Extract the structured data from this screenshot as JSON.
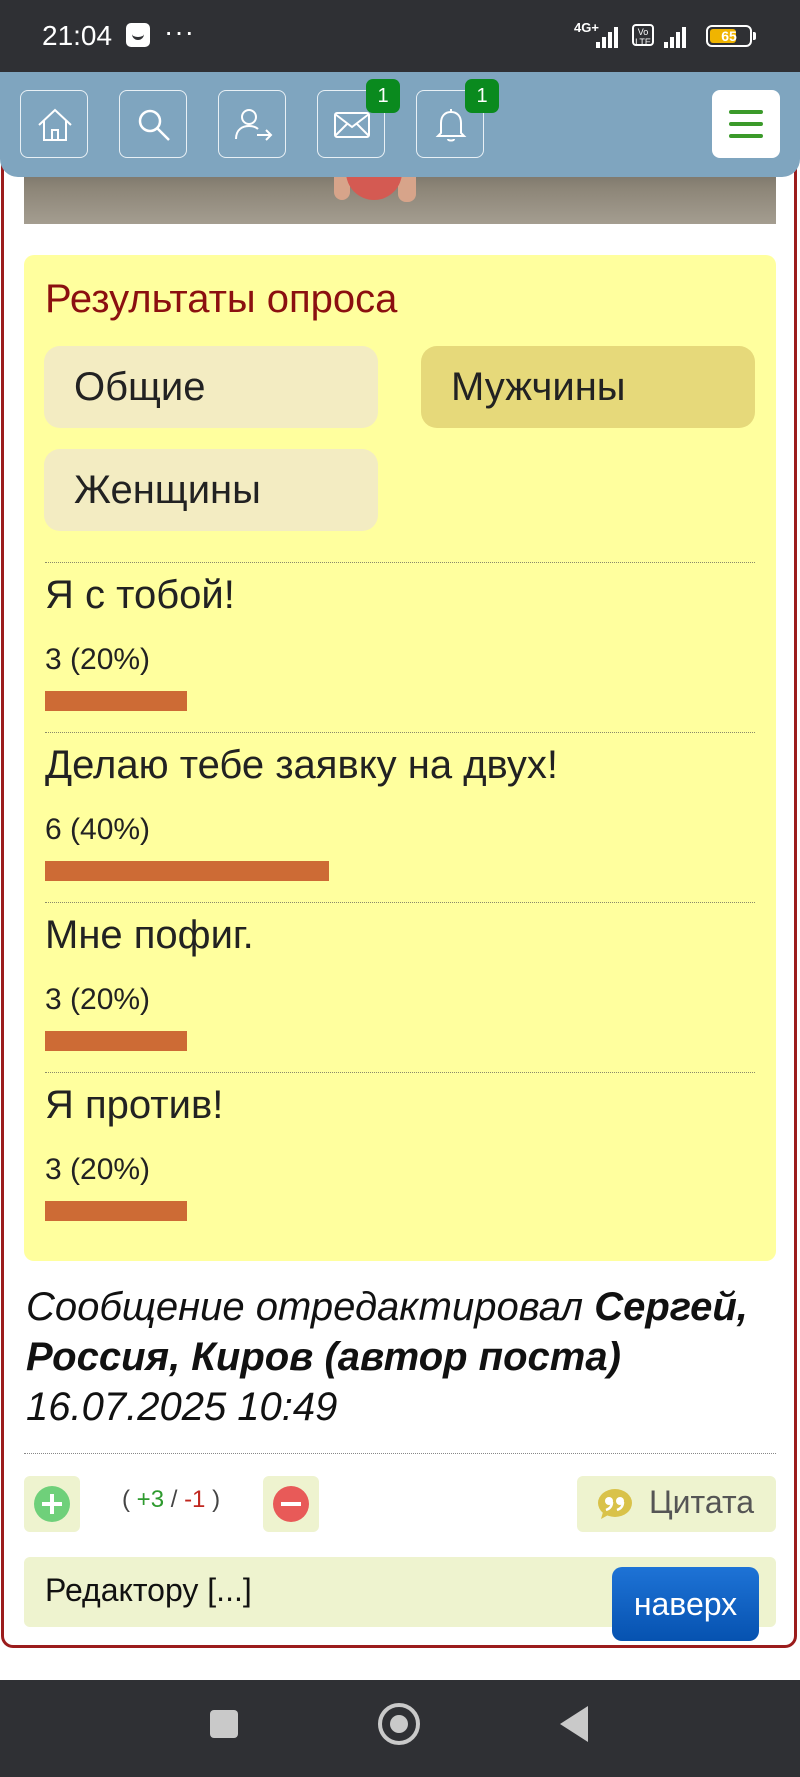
{
  "status_bar": {
    "time": "21:04",
    "network_label": "4G+",
    "volte_label": "Vo LTE",
    "battery_level": "65"
  },
  "top_nav": {
    "items": [
      {
        "icon": "home-icon"
      },
      {
        "icon": "search-icon"
      },
      {
        "icon": "user-login-icon"
      },
      {
        "icon": "mail-icon",
        "badge": "1"
      },
      {
        "icon": "bell-icon",
        "badge": "1"
      }
    ],
    "menu_icon": "hamburger-menu-icon"
  },
  "poll": {
    "title": "Результаты опроса",
    "tabs": [
      {
        "label": "Общие",
        "active": false
      },
      {
        "label": "Мужчины",
        "active": true
      },
      {
        "label": "Женщины",
        "active": false
      }
    ],
    "options": [
      {
        "text": "Я с тобой!",
        "count": "3 (20%)",
        "fraction": 0.2
      },
      {
        "text": "Делаю тебе заявку на двух!",
        "count": "6 (40%)",
        "fraction": 0.4
      },
      {
        "text": "Мне пофиг.",
        "count": "3 (20%)",
        "fraction": 0.2
      },
      {
        "text": "Я против!",
        "count": "3 (20%)",
        "fraction": 0.2
      }
    ]
  },
  "edit_note": {
    "prefix": "Сообщение отредактировал",
    "author": "Сергей, Россия, Киров (автор поста)",
    "datetime": "16.07.2025 10:49"
  },
  "rating": {
    "open": "(",
    "plus": "+3",
    "slash": "/",
    "minus": "-1",
    "close": ")"
  },
  "quote_label": "Цитата",
  "reply_label": "Редактору [...]",
  "to_top_label": "наверх",
  "colors": {
    "accent_red": "#8b1010",
    "poll_background": "#ffff9e",
    "bar": "#cd6b35",
    "nav_background": "#7fa5bf",
    "badge": "#0a8a1e",
    "up_button": "#0652b0"
  }
}
